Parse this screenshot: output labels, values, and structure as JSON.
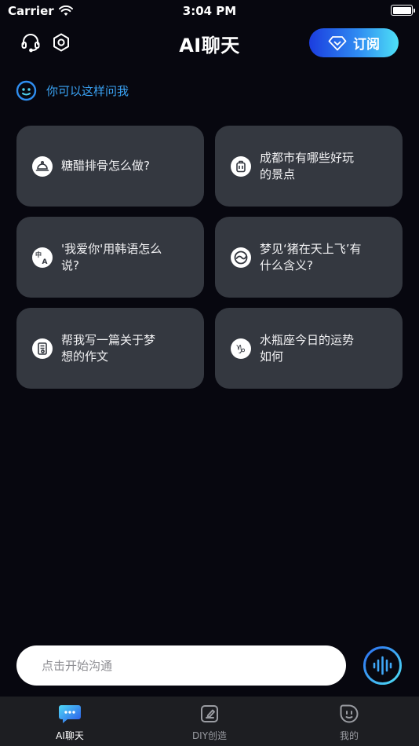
{
  "status_bar": {
    "carrier": "Carrier",
    "time": "3:04 PM",
    "battery_level": 1.0
  },
  "header": {
    "title": "AI聊天",
    "subscribe_label": "订阅"
  },
  "hint": {
    "text": "你可以这样问我"
  },
  "suggestions": [
    {
      "text": "糖醋排骨怎么做?",
      "icon": "cloche-icon"
    },
    {
      "text": "成都市有哪些好玩的景点",
      "icon": "luggage-icon"
    },
    {
      "text": "'我爱你'用韩语怎么说?",
      "icon": "translate-icon"
    },
    {
      "text": "梦见‘猪在天上飞’有什么含义?",
      "icon": "dream-icon"
    },
    {
      "text": "帮我写一篇关于梦想的作文",
      "icon": "document-icon"
    },
    {
      "text": "水瓶座今日的运势如何",
      "icon": "capricorn-icon"
    }
  ],
  "input": {
    "placeholder": "点击开始沟通"
  },
  "tabs": [
    {
      "label": "AI聊天",
      "icon": "chat-icon",
      "active": true
    },
    {
      "label": "DIY创造",
      "icon": "edit-icon",
      "active": false
    },
    {
      "label": "我的",
      "icon": "profile-icon",
      "active": false
    }
  ],
  "colors": {
    "accent": "#3aa3f5",
    "background": "#07070f",
    "card": "#343840"
  }
}
